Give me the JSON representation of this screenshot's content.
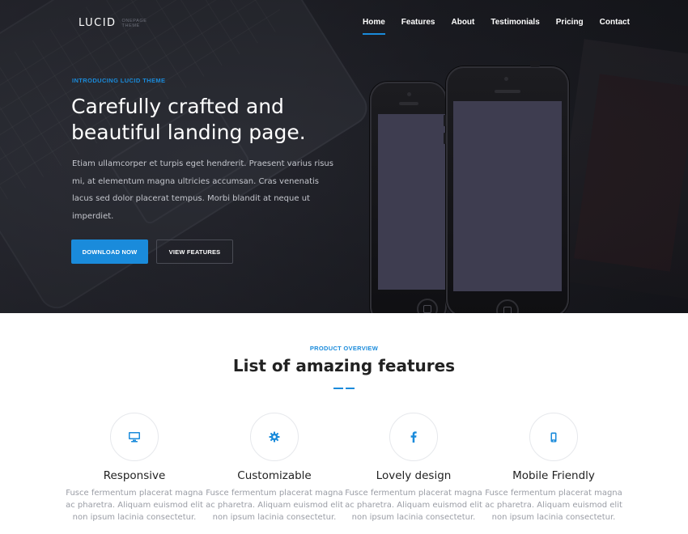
{
  "brand": {
    "name": "LUCID",
    "tagline_line1": "ONEPAGE",
    "tagline_line2": "THEME"
  },
  "nav": {
    "items": [
      {
        "label": "Home",
        "active": true
      },
      {
        "label": "Features",
        "active": false
      },
      {
        "label": "About",
        "active": false
      },
      {
        "label": "Testimonials",
        "active": false
      },
      {
        "label": "Pricing",
        "active": false
      },
      {
        "label": "Contact",
        "active": false
      }
    ]
  },
  "hero": {
    "kicker": "INTRODUCING LUCID THEME",
    "title": "Carefully crafted and beautiful landing page.",
    "body": "Etiam ullamcorper et turpis eget hendrerit. Praesent varius risus mi, at elementum magna ultricies accumsan. Cras venenatis lacus sed dolor placerat tempus. Morbi blandit at neque ut imperdiet.",
    "primary_button": "DOWNLOAD NOW",
    "secondary_button": "VIEW FEATURES"
  },
  "features": {
    "kicker": "PRODUCT OVERVIEW",
    "title": "List of amazing features",
    "items": [
      {
        "icon": "monitor-icon",
        "name": "Responsive",
        "desc": "Fusce fermentum placerat magna ac pharetra. Aliquam euismod elit non ipsum lacinia consectetur."
      },
      {
        "icon": "gear-icon",
        "name": "Customizable",
        "desc": "Fusce fermentum placerat magna ac pharetra. Aliquam euismod elit non ipsum lacinia consectetur."
      },
      {
        "icon": "facebook-icon",
        "name": "Lovely design",
        "desc": "Fusce fermentum placerat magna ac pharetra. Aliquam euismod elit non ipsum lacinia consectetur."
      },
      {
        "icon": "mobile-icon",
        "name": "Mobile Friendly",
        "desc": "Fusce fermentum placerat magna ac pharetra. Aliquam euismod elit non ipsum lacinia consectetur."
      }
    ]
  },
  "colors": {
    "accent": "#1a8bdb",
    "hero_bg": "#23242b",
    "screen": "#3e3d50"
  }
}
